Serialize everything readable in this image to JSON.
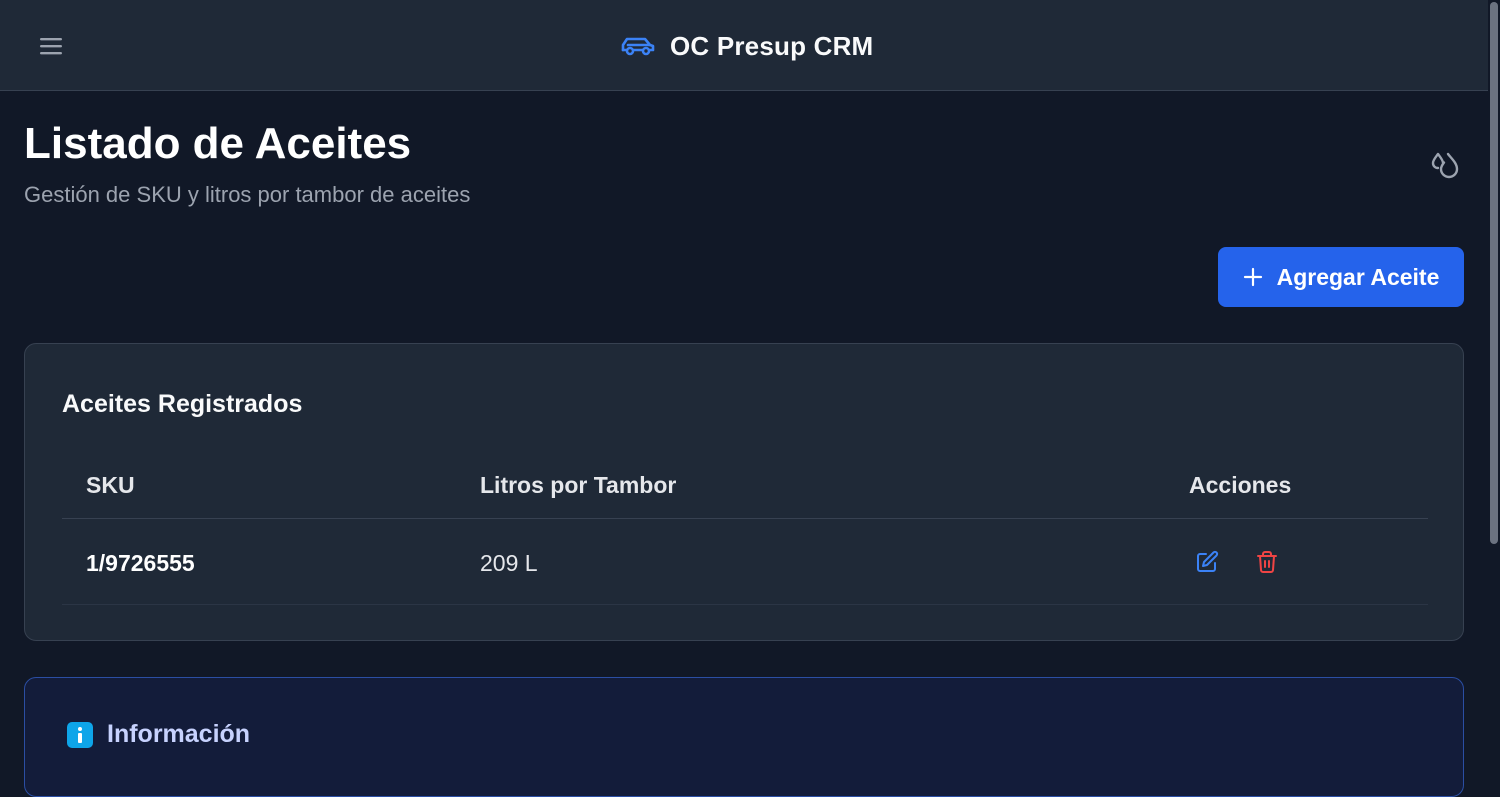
{
  "app": {
    "title": "OC Presup CRM",
    "brand_color": "#3b82f6"
  },
  "page": {
    "title": "Listado de Aceites",
    "subtitle": "Gestión de SKU y litros por tambor de aceites"
  },
  "actions": {
    "add_label": "Agregar Aceite"
  },
  "table": {
    "title": "Aceites Registrados",
    "columns": [
      "SKU",
      "Litros por Tambor",
      "Acciones"
    ],
    "rows": [
      {
        "sku": "1/9726555",
        "litros": "209 L"
      }
    ]
  },
  "info": {
    "title": "Información"
  },
  "icons": {
    "menu": "hamburger-menu-icon",
    "brand": "car-icon",
    "page": "droplets-icon",
    "add": "plus-icon",
    "edit": "edit-icon",
    "delete": "trash-icon",
    "info": "info-icon"
  },
  "colors": {
    "background": "#111827",
    "surface": "#1f2937",
    "primary": "#2563eb",
    "edit": "#3b82f6",
    "delete": "#ef4444"
  }
}
